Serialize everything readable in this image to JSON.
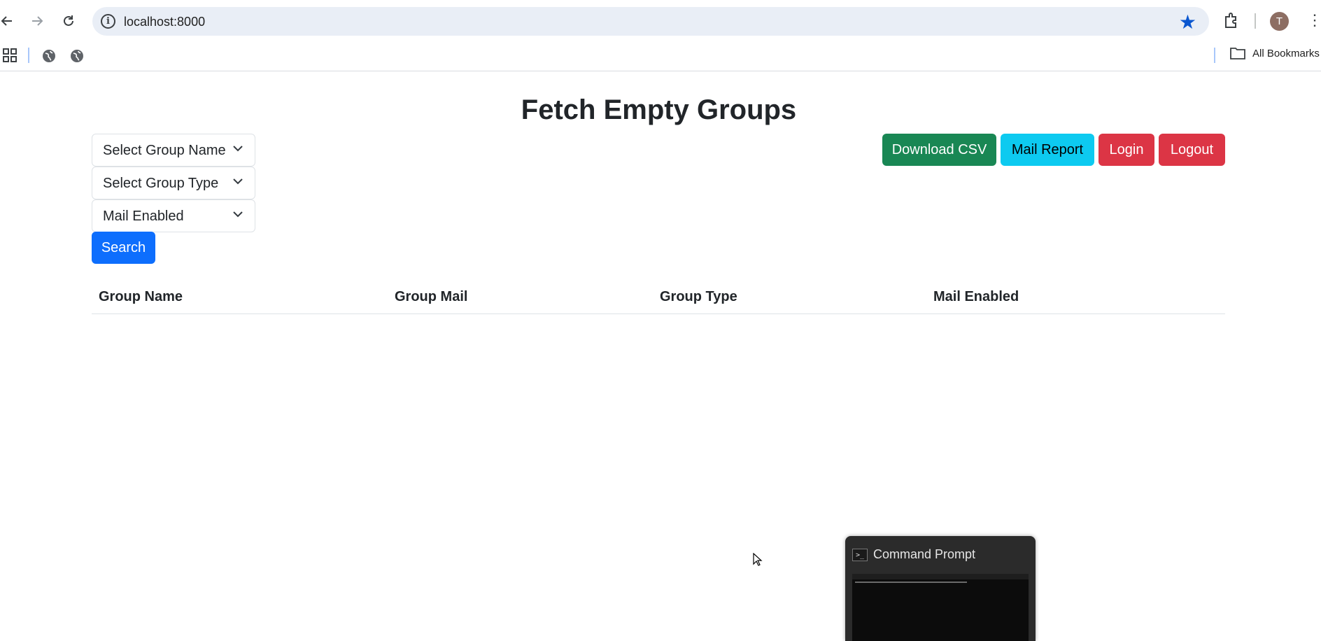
{
  "browser": {
    "url": "localhost:8000",
    "avatar_letter": "T",
    "all_bookmarks_label": "All Bookmarks"
  },
  "page": {
    "title": "Fetch Empty Groups",
    "filters": {
      "group_name": "Select Group Name",
      "group_type": "Select Group Type",
      "mail_enabled": "Mail Enabled"
    },
    "search_label": "Search",
    "actions": {
      "download_csv": "Download CSV",
      "mail_report": "Mail Report",
      "login": "Login",
      "logout": "Logout"
    },
    "table": {
      "columns": [
        "Group Name",
        "Group Mail",
        "Group Type",
        "Mail Enabled"
      ],
      "rows": []
    }
  },
  "taskbar_preview": {
    "title": "Command Prompt"
  },
  "colors": {
    "download_csv": "#198754",
    "mail_report": "#0dcaf0",
    "login": "#dc3545",
    "logout": "#dc3545",
    "search": "#0d6efd",
    "bookmark_star": "#0b57d0"
  }
}
